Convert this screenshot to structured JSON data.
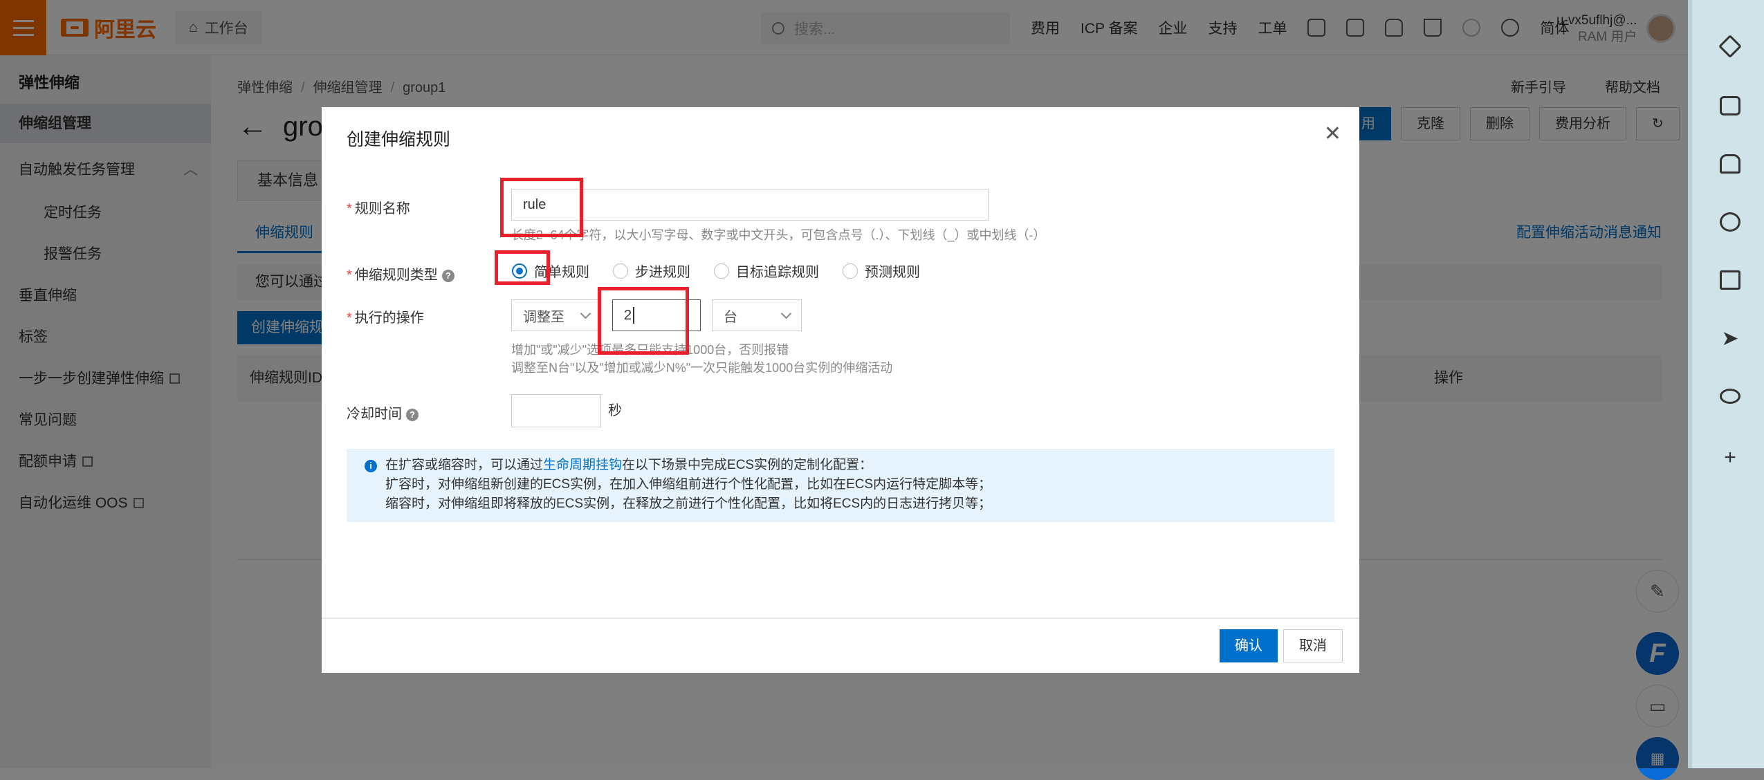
{
  "topbar": {
    "logo_text": "阿里云",
    "workbench": "工作台",
    "search_placeholder": "搜索...",
    "nav": [
      "费用",
      "ICP 备案",
      "企业",
      "支持",
      "工单"
    ],
    "lang": "简体",
    "user_name": "u-vx5uflhj@...",
    "user_role": "RAM 用户"
  },
  "sidebar": {
    "title": "弹性伸缩",
    "items": [
      {
        "label": "伸缩组管理"
      },
      {
        "label": "自动触发任务管理"
      },
      {
        "label": "定时任务"
      },
      {
        "label": "报警任务"
      },
      {
        "label": "垂直伸缩"
      },
      {
        "label": "标签"
      },
      {
        "label": "一步一步创建弹性伸缩"
      },
      {
        "label": "常见问题"
      },
      {
        "label": "配额申请"
      },
      {
        "label": "自动化运维 OOS"
      }
    ]
  },
  "main": {
    "breadcrumb": [
      "弹性伸缩",
      "伸缩组管理",
      "group1"
    ],
    "help_links": [
      "新手引导",
      "帮助文档"
    ],
    "title": "gro",
    "actions": [
      "用",
      "克隆",
      "删除",
      "费用分析"
    ],
    "tab_basic": "基本信息",
    "tab_rules": "伸缩规则",
    "notify_link": "配置伸缩活动消息通知",
    "tip": "您可以通过",
    "create_button": "创建伸缩规",
    "table_col_id": "伸缩规则ID/名",
    "table_col_op": "操作"
  },
  "modal": {
    "title": "创建伸缩规则",
    "rule_name_label": "规则名称",
    "rule_name_value": "rule",
    "rule_name_hint": "长度2~64个字符，以大小写字母、数字或中文开头，可包含点号（.）、下划线（_）或中划线（-）",
    "rule_type_label": "伸缩规则类型",
    "rule_types": [
      "简单规则",
      "步进规则",
      "目标追踪规则",
      "预测规则"
    ],
    "selected_rule_type": "简单规则",
    "operation_label": "执行的操作",
    "operation_select": "调整至",
    "operation_value": "2",
    "operation_unit": "台",
    "operation_hint_1": "增加\"或\"减少\"选项最多只能支持1000台，否则报错",
    "operation_hint_2": "调整至N台\"以及\"增加或减少N%\"一次只能触发1000台实例的伸缩活动",
    "cooldown_label": "冷却时间",
    "cooldown_value": "",
    "cooldown_unit": "秒",
    "info_line1_pre": "在扩容或缩容时，可以通过",
    "info_link": "生命周期挂钩",
    "info_line1_post": "在以下场景中完成ECS实例的定制化配置：",
    "info_line2": "扩容时，对伸缩组新创建的ECS实例，在加入伸缩组前进行个性化配置，比如在ECS内运行特定脚本等；",
    "info_line3": "缩容时，对伸缩组即将释放的ECS实例，在释放之前进行个性化配置，比如将ECS内的日志进行拷贝等；",
    "confirm": "确认",
    "cancel": "取消"
  },
  "colors": {
    "accent": "#0070cc",
    "brand": "#ff6a00",
    "highlight": "#e8202a",
    "rightbar_bg": "#cfe3e8"
  }
}
